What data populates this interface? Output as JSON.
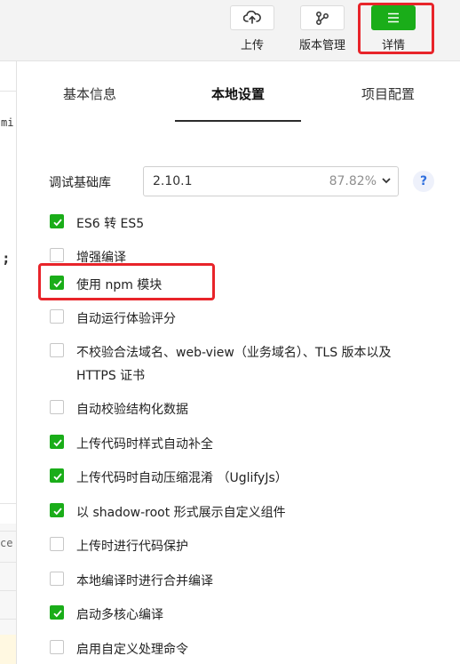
{
  "toolbar": {
    "upload_label": "上传",
    "version_label": "版本管理",
    "details_label": "详情",
    "active_color": "#1aad19",
    "highlight_color": "#e8242a"
  },
  "editor_peek": {
    "code_snippet": "mi",
    "semicolon": ";",
    "fragment": "ce"
  },
  "tabs": [
    {
      "label": "基本信息",
      "active": false
    },
    {
      "label": "本地设置",
      "active": true
    },
    {
      "label": "项目配置",
      "active": false
    }
  ],
  "base_library": {
    "label": "调试基础库",
    "version": "2.10.1",
    "coverage": "87.82%",
    "help": "?"
  },
  "options": [
    {
      "label": "ES6 转 ES5",
      "checked": true
    },
    {
      "label": "增强编译",
      "checked": false
    },
    {
      "label": "使用 npm 模块",
      "checked": true,
      "highlighted": true
    },
    {
      "label": "自动运行体验评分",
      "checked": false
    },
    {
      "label": "不校验合法域名、web-view（业务域名）、TLS 版本以及 HTTPS 证书",
      "checked": false
    },
    {
      "label": "自动校验结构化数据",
      "checked": false
    },
    {
      "label": "上传代码时样式自动补全",
      "checked": true
    },
    {
      "label": "上传代码时自动压缩混淆 （UglifyJs）",
      "checked": true
    },
    {
      "label": "以 shadow-root 形式展示自定义组件",
      "checked": true
    },
    {
      "label": "上传时进行代码保护",
      "checked": false
    },
    {
      "label": "本地编译时进行合并编译",
      "checked": false
    },
    {
      "label": "启动多核心编译",
      "checked": true
    },
    {
      "label": "启用自定义处理命令",
      "checked": false
    }
  ]
}
